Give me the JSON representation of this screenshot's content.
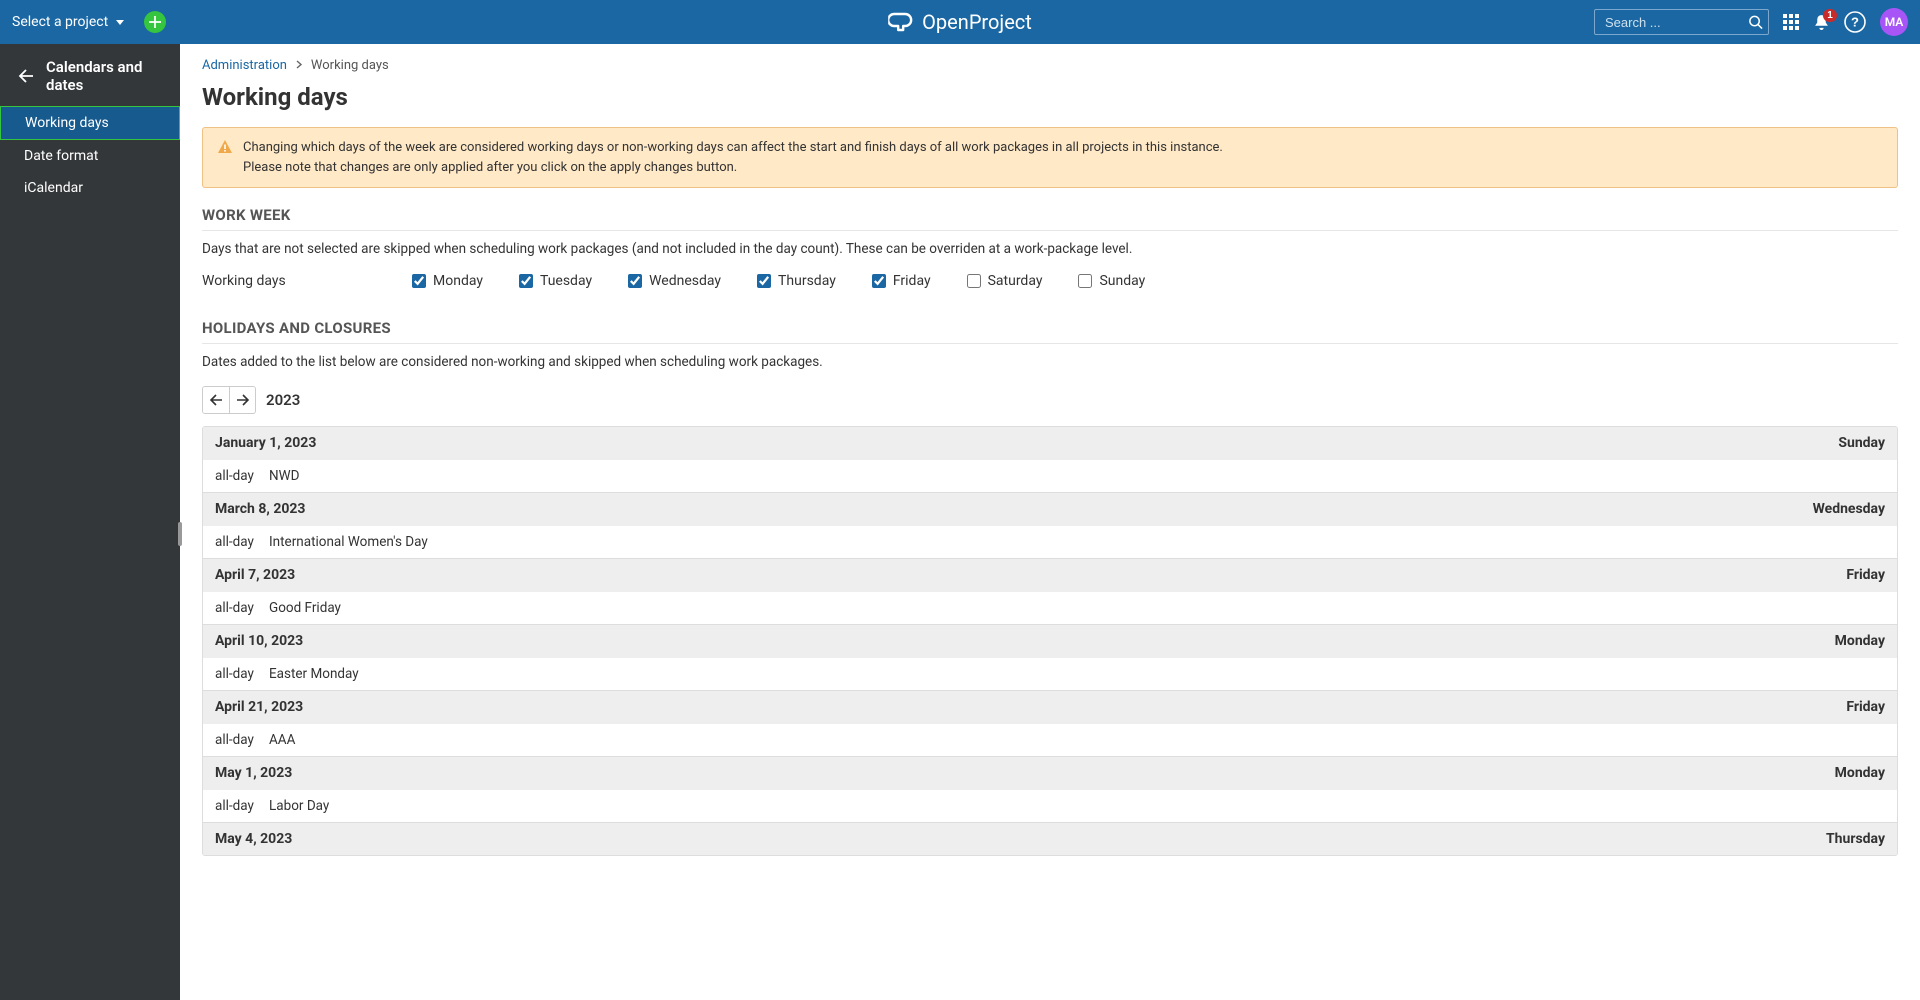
{
  "header": {
    "project_selector": "Select a project",
    "app_name": "OpenProject",
    "search_placeholder": "Search ...",
    "notification_count": "1",
    "avatar_initials": "MA"
  },
  "sidebar": {
    "title": "Calendars and dates",
    "items": [
      {
        "label": "Working days",
        "active": true
      },
      {
        "label": "Date format",
        "active": false
      },
      {
        "label": "iCalendar",
        "active": false
      }
    ]
  },
  "breadcrumb": {
    "root": "Administration",
    "current": "Working days"
  },
  "page": {
    "title": "Working days",
    "warning_line1": "Changing which days of the week are considered working days or non-working days can affect the start and finish days of all work packages in all projects in this instance.",
    "warning_line2": "Please note that changes are only applied after you click on the apply changes button."
  },
  "workweek": {
    "section_title": "WORK WEEK",
    "desc": "Days that are not selected are skipped when scheduling work packages (and not included in the day count). These can be overriden at a work-package level.",
    "row_label": "Working days",
    "days": [
      {
        "label": "Monday",
        "checked": true
      },
      {
        "label": "Tuesday",
        "checked": true
      },
      {
        "label": "Wednesday",
        "checked": true
      },
      {
        "label": "Thursday",
        "checked": true
      },
      {
        "label": "Friday",
        "checked": true
      },
      {
        "label": "Saturday",
        "checked": false
      },
      {
        "label": "Sunday",
        "checked": false
      }
    ]
  },
  "holidays": {
    "section_title": "HOLIDAYS AND CLOSURES",
    "desc": "Dates added to the list below are considered non-working and skipped when scheduling work packages.",
    "year": "2023",
    "entries": [
      {
        "date": "January 1, 2023",
        "dow": "Sunday",
        "time": "all-day",
        "name": "NWD"
      },
      {
        "date": "March 8, 2023",
        "dow": "Wednesday",
        "time": "all-day",
        "name": "International Women's Day"
      },
      {
        "date": "April 7, 2023",
        "dow": "Friday",
        "time": "all-day",
        "name": "Good Friday"
      },
      {
        "date": "April 10, 2023",
        "dow": "Monday",
        "time": "all-day",
        "name": "Easter Monday"
      },
      {
        "date": "April 21, 2023",
        "dow": "Friday",
        "time": "all-day",
        "name": "AAA"
      },
      {
        "date": "May 1, 2023",
        "dow": "Monday",
        "time": "all-day",
        "name": "Labor Day"
      },
      {
        "date": "May 4, 2023",
        "dow": "Thursday",
        "time": "",
        "name": ""
      }
    ]
  }
}
